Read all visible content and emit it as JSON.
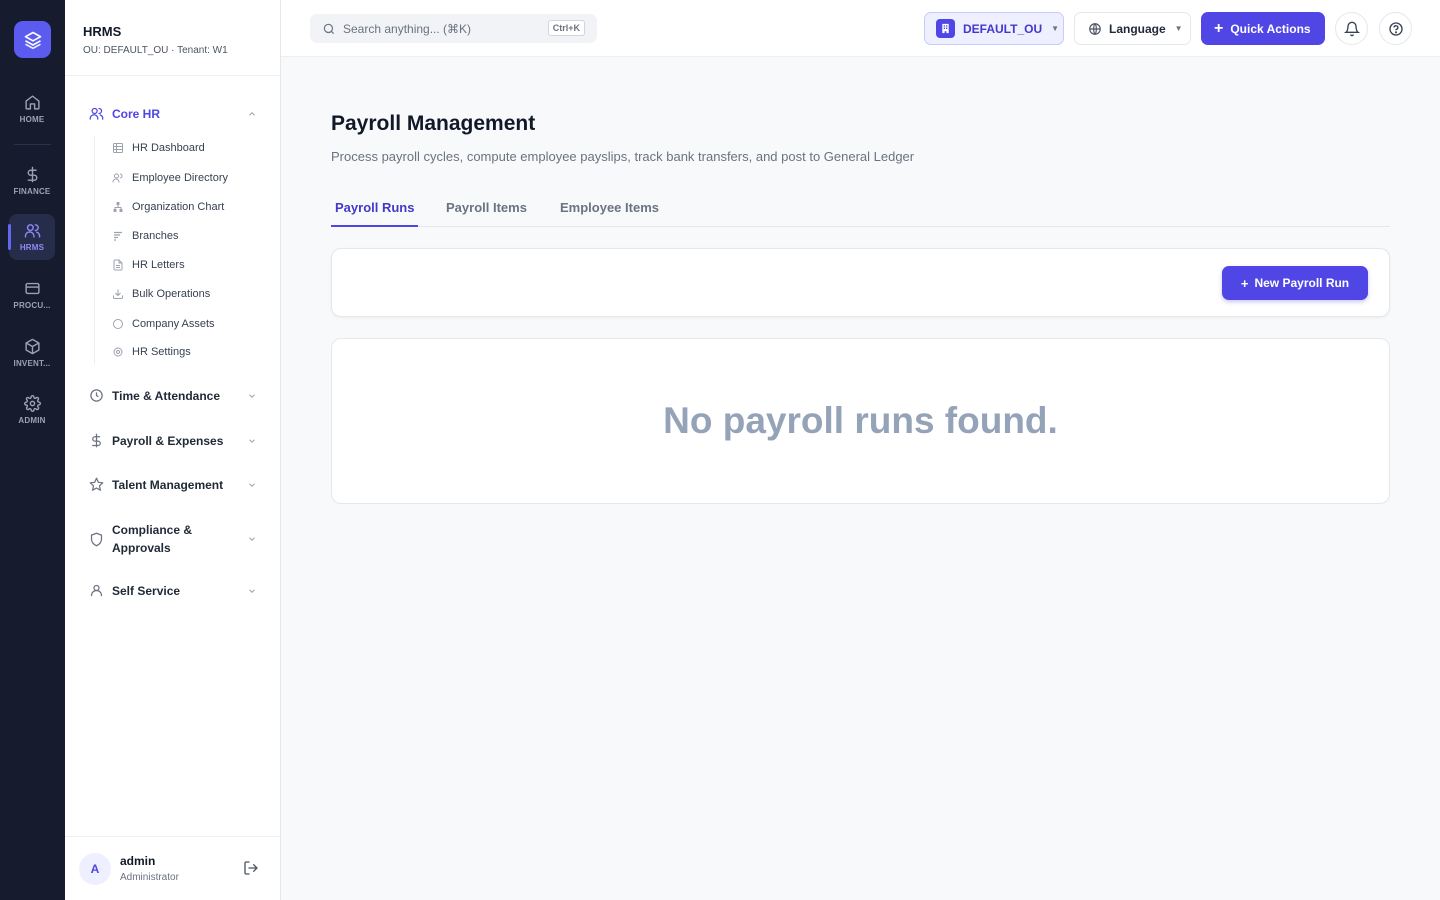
{
  "rail": {
    "items": [
      {
        "label": "HOME",
        "icon": "home-icon"
      },
      {
        "label": "FINANCE",
        "icon": "dollar-icon"
      },
      {
        "label": "HRMS",
        "icon": "users-icon",
        "active": true
      },
      {
        "label": "PROCU...",
        "icon": "card-icon"
      },
      {
        "label": "INVENT...",
        "icon": "box-icon"
      },
      {
        "label": "ADMIN",
        "icon": "gear-icon"
      }
    ]
  },
  "sidebar": {
    "title": "HRMS",
    "subtitle": "OU: DEFAULT_OU · Tenant: W1",
    "groups": [
      {
        "label": "Core HR",
        "icon": "users-icon",
        "expanded": true
      },
      {
        "label": "Time & Attendance",
        "icon": "clock-icon"
      },
      {
        "label": "Payroll & Expenses",
        "icon": "dollar-icon"
      },
      {
        "label": "Talent Management",
        "icon": "star-icon"
      },
      {
        "label": "Compliance & Approvals",
        "icon": "shield-icon"
      },
      {
        "label": "Self Service",
        "icon": "user-icon"
      }
    ],
    "core_hr_items": [
      {
        "label": "HR Dashboard",
        "icon": "table-icon"
      },
      {
        "label": "Employee Directory",
        "icon": "users-icon"
      },
      {
        "label": "Organization Chart",
        "icon": "org-chart-icon"
      },
      {
        "label": "Branches",
        "icon": "branch-icon"
      },
      {
        "label": "HR Letters",
        "icon": "document-icon"
      },
      {
        "label": "Bulk Operations",
        "icon": "download-icon"
      },
      {
        "label": "Company Assets",
        "icon": "circle-icon"
      },
      {
        "label": "HR Settings",
        "icon": "gear-icon"
      }
    ],
    "user": {
      "initial": "A",
      "name": "admin",
      "role": "Administrator"
    }
  },
  "topbar": {
    "search_placeholder": "Search anything... (⌘K)",
    "shortcut": "Ctrl+K",
    "ou_label": "DEFAULT_OU",
    "language_label": "Language",
    "quick_actions_label": "Quick Actions"
  },
  "main": {
    "title": "Payroll Management",
    "description": "Process payroll cycles, compute employee payslips, track bank transfers, and post to General Ledger",
    "tabs": [
      {
        "label": "Payroll Runs",
        "active": true
      },
      {
        "label": "Payroll Items"
      },
      {
        "label": "Employee Items"
      }
    ],
    "new_run_label": "New Payroll Run",
    "new_run_plus": "+",
    "empty_message": "No payroll runs found."
  },
  "colors": {
    "accent": "#4f46e5",
    "rail_bg": "#161b2e",
    "muted": "#94a3b8"
  }
}
